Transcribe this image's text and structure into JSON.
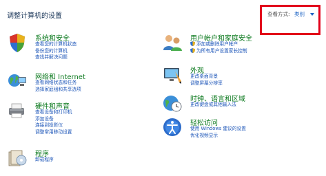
{
  "page": {
    "title": "调整计算机的设置"
  },
  "view": {
    "label": "查看方式:",
    "value": "类别"
  },
  "categories": [
    {
      "title": "系统和安全",
      "links": [
        "查看您的计算机状态",
        "备份您的计算机",
        "查找并解决问题"
      ]
    },
    {
      "title": "网络和 Internet",
      "links": [
        "查看网络状态和任务",
        "选择家庭组和共享选项"
      ]
    },
    {
      "title": "硬件和声音",
      "links": [
        "查看设备和打印机",
        "添加设备",
        "连接到投影仪",
        "调整常用移动设置"
      ]
    },
    {
      "title": "程序",
      "links": [
        "卸载程序"
      ]
    },
    {
      "title": "用户帐户和家庭安全",
      "links": [
        "添加或删除用户帐户",
        "为所有用户设置家长控制"
      ]
    },
    {
      "title": "外观",
      "links": [
        "更改桌面背景",
        "调整屏幕分辨率"
      ]
    },
    {
      "title": "时钟、语言和区域",
      "links": [
        "更改键盘或其他输入法"
      ]
    },
    {
      "title": "轻松访问",
      "links": [
        "使用 Windows 建议的设置",
        "优化视频显示"
      ]
    }
  ]
}
